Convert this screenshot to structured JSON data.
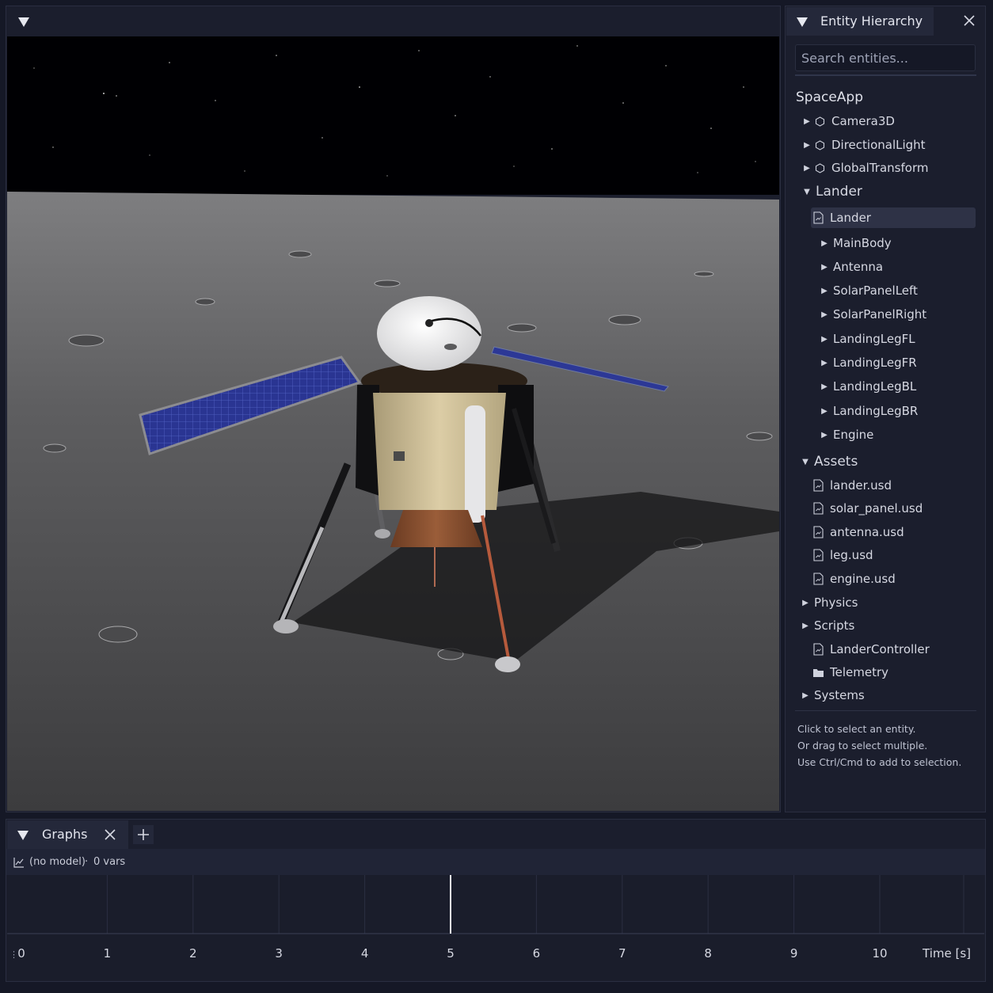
{
  "viewport": {},
  "hierarchy": {
    "title": "Entity Hierarchy",
    "search_placeholder": "Search entities...",
    "root": "SpaceApp",
    "items": [
      {
        "label": "Camera3D",
        "arrow": "▶",
        "icon": "component"
      },
      {
        "label": "DirectionalLight",
        "arrow": "▶",
        "icon": "component"
      },
      {
        "label": "GlobalTransform",
        "arrow": "▶",
        "icon": "component"
      },
      {
        "label": "Lander",
        "arrow": "▼",
        "icon": "none"
      },
      {
        "label": "Lander",
        "arrow": "",
        "icon": "file"
      },
      {
        "label": "MainBody",
        "arrow": "▶",
        "icon": "none"
      },
      {
        "label": "Antenna",
        "arrow": "▶",
        "icon": "none"
      },
      {
        "label": "SolarPanelLeft",
        "arrow": "▶",
        "icon": "none"
      },
      {
        "label": "SolarPanelRight",
        "arrow": "▶",
        "icon": "none"
      },
      {
        "label": "LandingLegFL",
        "arrow": "▶",
        "icon": "none"
      },
      {
        "label": "LandingLegFR",
        "arrow": "▶",
        "icon": "none"
      },
      {
        "label": "LandingLegBL",
        "arrow": "▶",
        "icon": "none"
      },
      {
        "label": "LandingLegBR",
        "arrow": "▶",
        "icon": "none"
      },
      {
        "label": "Engine",
        "arrow": "▶",
        "icon": "none"
      },
      {
        "label": "Assets",
        "arrow": "▼",
        "icon": "none"
      },
      {
        "label": "lander.usd",
        "arrow": "",
        "icon": "file"
      },
      {
        "label": "solar_panel.usd",
        "arrow": "",
        "icon": "file"
      },
      {
        "label": "antenna.usd",
        "arrow": "",
        "icon": "file"
      },
      {
        "label": "leg.usd",
        "arrow": "",
        "icon": "file"
      },
      {
        "label": "engine.usd",
        "arrow": "",
        "icon": "file"
      },
      {
        "label": "Physics",
        "arrow": "▶",
        "icon": "none"
      },
      {
        "label": "Scripts",
        "arrow": "▶",
        "icon": "none"
      },
      {
        "label": "LanderController",
        "arrow": "",
        "icon": "file"
      },
      {
        "label": "Telemetry",
        "arrow": "",
        "icon": "folder"
      },
      {
        "label": "Systems",
        "arrow": "▶",
        "icon": "none"
      }
    ],
    "help_lines": [
      "Click to select an entity.",
      "Or drag to select multiple.",
      "Use Ctrl/Cmd to add to selection."
    ]
  },
  "graphs": {
    "tab_label": "Graphs",
    "model": "(no model)",
    "separator": "·",
    "vars": "0 vars",
    "time_ticks": [
      "0",
      "1",
      "2",
      "3",
      "4",
      "5",
      "6",
      "7",
      "8",
      "9",
      "10"
    ],
    "time_label": "Time [s]",
    "cursor_time": 5
  },
  "colors": {
    "panel_bg": "#1b1e2d",
    "tab_bg": "#24283a",
    "selection_bg": "#2e3246",
    "text": "#d9dbe4"
  }
}
